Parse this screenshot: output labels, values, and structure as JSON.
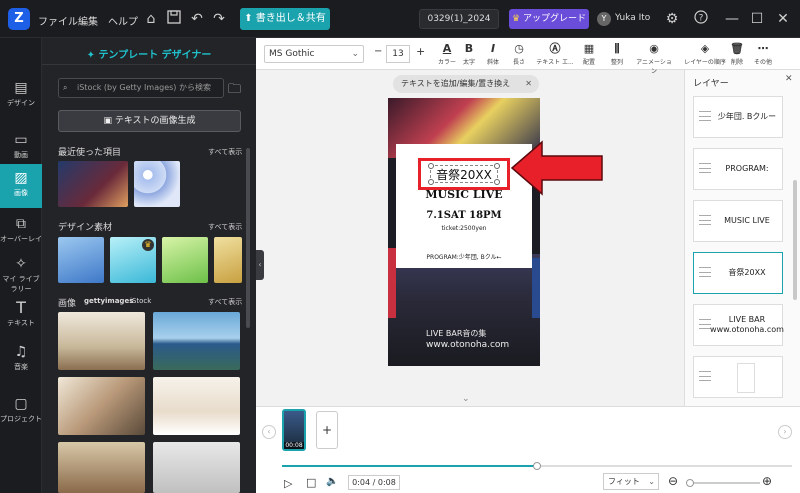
{
  "topbar": {
    "logo": "Z",
    "menus": [
      "ファイル",
      "編集",
      "ヘルプ"
    ],
    "export_label": "書き出し＆共有",
    "project_name": "0329(1)_2024",
    "upgrade_label": "アップグレード",
    "avatar_initial": "Y",
    "user_name": "Yuka Ito"
  },
  "tools": [
    {
      "label": "デザイン",
      "icon": "layout-icon"
    },
    {
      "label": "動画",
      "icon": "video-icon"
    },
    {
      "label": "画像",
      "icon": "image-icon"
    },
    {
      "label": "オーバーレイ",
      "icon": "overlay-icon"
    },
    {
      "label": "マイ ライブラリー",
      "icon": "library-icon"
    },
    {
      "label": "テキスト",
      "icon": "text-icon"
    },
    {
      "label": "音楽",
      "icon": "music-icon"
    },
    {
      "label": "プロジェクト",
      "icon": "folder-icon"
    }
  ],
  "panel": {
    "title": "テンプレート デザイナー",
    "search_placeholder": "iStock (by Getty Images) から検索",
    "generate_label": "テキストの画像生成",
    "recent_title": "最近使った項目",
    "design_title": "デザイン素材",
    "images_title": "画像",
    "getty": "gettyimages",
    "istock": "iStock",
    "see_all": "すべて表示"
  },
  "format": {
    "font": "MS Gothic",
    "size": "13",
    "buttons": [
      "カラー",
      "太字",
      "斜体",
      "長さ",
      "テキスト エ...",
      "配置",
      "整列",
      "アニメーション",
      "レイヤーの順序",
      "削除",
      "その他"
    ]
  },
  "canvas": {
    "tip": "テキストを追加/編集/置き換え"
  },
  "poster": {
    "title": "音祭20XX",
    "subtitle": "MUSIC LIVE",
    "date": "7.1SAT 18PM",
    "ticket": "ticket:2500yen",
    "program": "PROGRAM:少年団, Bクル←",
    "venue": "LIVE BAR音の集",
    "url": "www.otonoha.com"
  },
  "layers": {
    "title": "レイヤー",
    "items": [
      "少年団. Bクルー",
      "PROGRAM:",
      "MUSIC LIVE",
      "音祭20XX",
      "LIVE BAR www.otonoha.com",
      ""
    ]
  },
  "timeline": {
    "clip_duration": "00:08",
    "time": "0:04 / 0:08",
    "zoom": "フィット",
    "progress": 0.5
  },
  "colors": {
    "accent": "#1aa2ad",
    "upgrade": "#6a4dd8",
    "annotation": "#e8202a"
  }
}
